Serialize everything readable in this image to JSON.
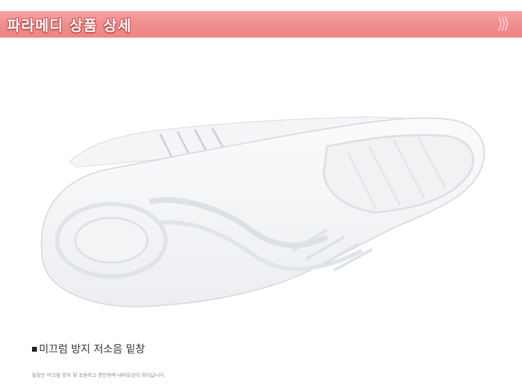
{
  "banner": {
    "title": "파라메디 상품 상세",
    "arrows": "⟩⟩⟩",
    "accent_color": "#f08c8c"
  },
  "product": {
    "image_icon": "shoe-sole-icon"
  },
  "feature": {
    "heading": "미끄럼 방지 저소음 밑창",
    "bullet": "bullet-square-icon",
    "description": "밑창은 미끄럼 방지 및 조용하고 편안하며 내마모성이 뛰어납니다."
  }
}
